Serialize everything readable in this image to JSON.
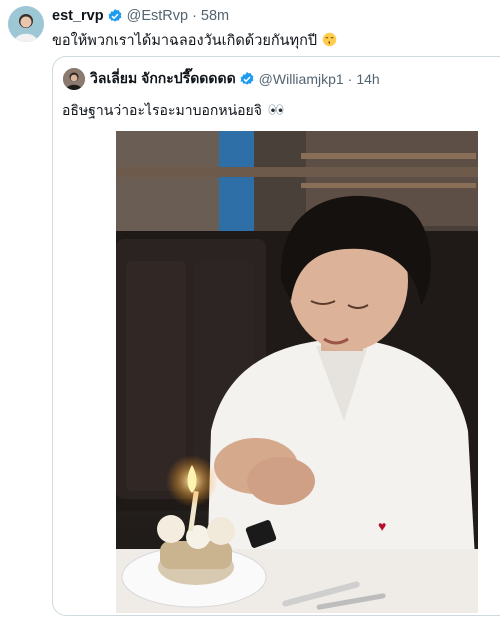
{
  "tweet": {
    "author_name": "est_rvp",
    "handle": "@EstRvp",
    "separator": "·",
    "time": "58m",
    "text": "ขอให้พวกเราได้มาฉลองวันเกิดด้วยกันทุกปี",
    "emoji": "kissing-face-emoji"
  },
  "quoted": {
    "author_name": "วิลเลี่ยม จักกะปรี๊ดดดดด",
    "handle": "@Williamjkp1",
    "separator": "·",
    "time": "14h",
    "text": "อธิษฐานว่าอะไรอะมาบอกหน่อยจิ",
    "emoji": "eyes-emoji"
  },
  "colors": {
    "verified": "#1d9bf0",
    "muted": "#536471",
    "border": "#cfd9de",
    "text": "#0f1419"
  }
}
